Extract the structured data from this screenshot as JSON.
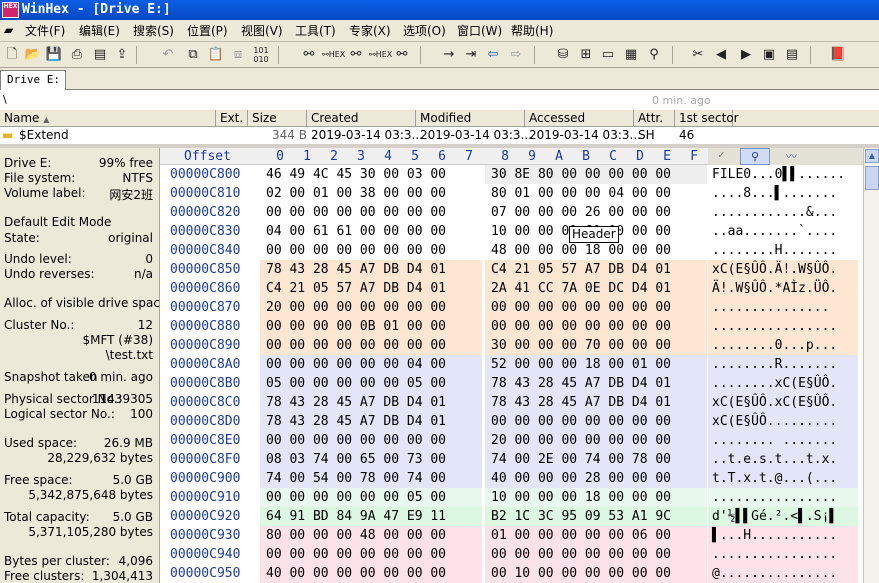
{
  "window": {
    "title": "WinHex - [Drive E:]",
    "app_icon_text": "HEX"
  },
  "menu": [
    "文件(F)",
    "编辑(E)",
    "搜索(S)",
    "位置(P)",
    "视图(V)",
    "工具(T)",
    "专家(X)",
    "选项(O)",
    "窗口(W)",
    "帮助(H)"
  ],
  "tab": {
    "label": "Drive E:"
  },
  "path": {
    "current": "\\",
    "age": "0 min. ago"
  },
  "files": {
    "columns": [
      "Name",
      "Ext.",
      "Size",
      "Created",
      "Modified",
      "Accessed",
      "Attr.",
      "1st sector"
    ],
    "rows": [
      {
        "name": "$Extend",
        "ext": "",
        "size": "344 B",
        "created": "2019-03-14  03:3...",
        "modified": "2019-03-14  03:3...",
        "accessed": "2019-03-14  03:3...",
        "attr": "SH",
        "first_sector": "46"
      }
    ]
  },
  "sidebar": {
    "drive": "Drive E:",
    "free_pct": "99% free",
    "fs_label": "File system:",
    "fs": "NTFS",
    "vol_label": "Volume label:",
    "vol": "网安2班",
    "edit_mode_label": "Default Edit Mode",
    "state_label": "State:",
    "state": "original",
    "undo_level_label": "Undo level:",
    "undo_level": "0",
    "undo_rev_label": "Undo reverses:",
    "undo_rev": "n/a",
    "alloc_label": "Alloc. of visible drive space:",
    "cluster_label": "Cluster No.:",
    "cluster": "12",
    "mft": "$MFT (#38)",
    "file": "\\test.txt",
    "snapshot_label": "Snapshot taken",
    "snapshot": "0 min. ago",
    "phys_label": "Physical sector No.:",
    "phys": "11439305",
    "logical_label": "Logical sector No.:",
    "logical": "100",
    "used_label": "Used space:",
    "used": "26.9 MB",
    "used_bytes": "28,229,632 bytes",
    "free_label": "Free space:",
    "free": "5.0 GB",
    "free_bytes": "5,342,875,648 bytes",
    "total_label": "Total capacity:",
    "total": "5.0 GB",
    "total_bytes": "5,371,105,280 bytes",
    "bps_label": "Bytes per cluster:",
    "bps": "4,096",
    "freec_label": "Free clusters:",
    "freec": "1,304,413"
  },
  "hex": {
    "offset_label": "Offset",
    "columns": [
      "0",
      "1",
      "2",
      "3",
      "4",
      "5",
      "6",
      "7",
      "8",
      "9",
      "A",
      "B",
      "C",
      "D",
      "E",
      "F"
    ],
    "rows": [
      {
        "off": "00000C800",
        "b": "46 49 4C 45 30 00 03 00",
        "c": "30 8E 80 00 00 00 00 00",
        "t": "FILE0...0▌▌......"
      },
      {
        "off": "00000C810",
        "b": "02 00 01 00 38 00 00 00",
        "c": "80 01 00 00 00 04 00 00",
        "t": "....8...▌......."
      },
      {
        "off": "00000C820",
        "b": "00 00 00 00 00 00 00 00",
        "c": "07 00 00 00 26 00 00 00",
        "t": "............&..."
      },
      {
        "off": "00000C830",
        "b": "04 00 61 61 00 00 00 00",
        "c": "10 00 00 00 60 00 00 00",
        "t": "..aa.......`...."
      },
      {
        "off": "00000C840",
        "b": "00 00 00 00 00 00 00 00",
        "c": "48 00 00 00 18 00 00 00",
        "t": "........H......."
      },
      {
        "off": "00000C850",
        "b": "78 43 28 45 A7 DB D4 01",
        "c": "C4 21 05 57 A7 DB D4 01",
        "t": "xC(E§ÛÔ.Ä!.W§ÛÔ."
      },
      {
        "off": "00000C860",
        "b": "C4 21 05 57 A7 DB D4 01",
        "c": "2A 41 CC 7A 0E DC D4 01",
        "t": "Ä!.W§ÛÔ.*AÌz.ÜÔ."
      },
      {
        "off": "00000C870",
        "b": "20 00 00 00 00 00 00 00",
        "c": "00 00 00 00 00 00 00 00",
        "t": " ..............."
      },
      {
        "off": "00000C880",
        "b": "00 00 00 00 0B 01 00 00",
        "c": "00 00 00 00 00 00 00 00",
        "t": "................"
      },
      {
        "off": "00000C890",
        "b": "00 00 00 00 00 00 00 00",
        "c": "30 00 00 00 70 00 00 00",
        "t": "........0...p..."
      },
      {
        "off": "00000C8A0",
        "b": "00 00 00 00 00 00 04 00",
        "c": "52 00 00 00 18 00 01 00",
        "t": "........R......."
      },
      {
        "off": "00000C8B0",
        "b": "05 00 00 00 00 00 05 00",
        "c": "78 43 28 45 A7 DB D4 01",
        "t": "........xC(E§ÛÔ."
      },
      {
        "off": "00000C8C0",
        "b": "78 43 28 45 A7 DB D4 01",
        "c": "78 43 28 45 A7 DB D4 01",
        "t": "xC(E§ÛÔ.xC(E§ÛÔ."
      },
      {
        "off": "00000C8D0",
        "b": "78 43 28 45 A7 DB D4 01",
        "c": "00 00 00 00 00 00 00 00",
        "t": "xC(E§ÛÔ........."
      },
      {
        "off": "00000C8E0",
        "b": "00 00 00 00 00 00 00 00",
        "c": "20 00 00 00 00 00 00 00",
        "t": "........ ......."
      },
      {
        "off": "00000C8F0",
        "b": "08 03 74 00 65 00 73 00",
        "c": "74 00 2E 00 74 00 78 00",
        "t": "..t.e.s.t...t.x."
      },
      {
        "off": "00000C900",
        "b": "74 00 54 00 78 00 74 00",
        "c": "40 00 00 00 28 00 00 00",
        "t": "t.T.x.t.@...(..."
      },
      {
        "off": "00000C910",
        "b": "00 00 00 00 00 00 05 00",
        "c": "10 00 00 00 18 00 00 00",
        "t": "................"
      },
      {
        "off": "00000C920",
        "b": "64 91 BD 84 9A 47 E9 11",
        "c": "B2 1C 3C 95 09 53 A1 9C",
        "t": "d'½▌▌Gé.².<▌.S¡▌"
      },
      {
        "off": "00000C930",
        "b": "80 00 00 00 48 00 00 00",
        "c": "01 00 00 00 00 00 06 00",
        "t": "▌...H..........."
      },
      {
        "off": "00000C940",
        "b": "00 00 00 00 00 00 00 00",
        "c": "00 00 00 00 00 00 00 00",
        "t": "................"
      },
      {
        "off": "00000C950",
        "b": "40 00 00 00 00 00 00 00",
        "c": "00 10 00 00 00 00 00 00",
        "t": "@..............."
      }
    ],
    "tooltip": "Header"
  },
  "colors": {
    "range": [
      "#ffffff",
      "#ffffff",
      "#ffffff",
      "#ffffff",
      "#ffffff",
      "#fde6d2",
      "#fde6d2",
      "#fde6d2",
      "#fde6d2",
      "#fde6d2",
      "#e2e6f8",
      "#e2e6f8",
      "#e2e6f8",
      "#e2e6f8",
      "#e2e6f8",
      "#e2e6f8",
      "#e2e6f8",
      "#e8f8ec",
      "#dcf7e2",
      "#fde3e8",
      "#fde3e8",
      "#fde3e8"
    ]
  }
}
